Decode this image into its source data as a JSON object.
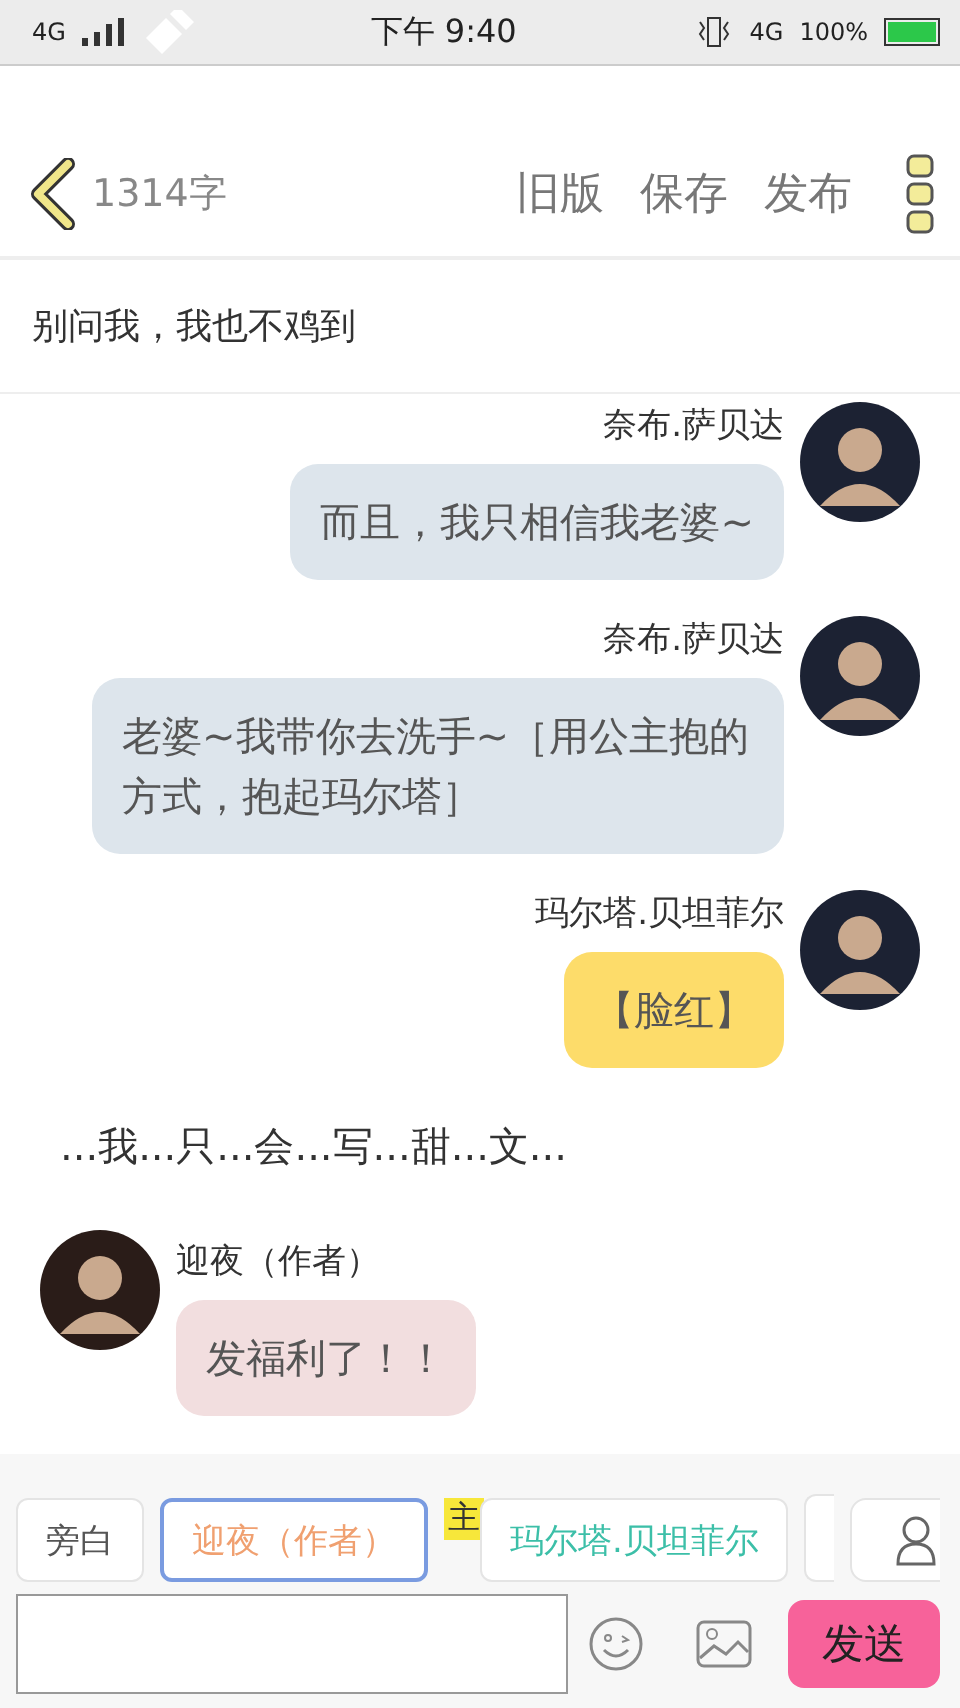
{
  "status_bar": {
    "network": "4G",
    "time": "下午 9:40",
    "network_2": "4G",
    "battery": "100%"
  },
  "header": {
    "word_count": "1314字",
    "actions": [
      "旧版",
      "保存",
      "发布"
    ]
  },
  "topic": "别问我，我也不鸡到",
  "messages": [
    {
      "kind": "right",
      "speaker": "奈布.萨贝达",
      "text": "而且，我只相信我老婆~",
      "color": "#dde5ec"
    },
    {
      "kind": "right",
      "speaker": "奈布.萨贝达",
      "text": "老婆~我带你去洗手~［用公主抱的方式，抱起玛尔塔］",
      "color": "#dde5ec"
    },
    {
      "kind": "right",
      "speaker": "玛尔塔.贝坦菲尔",
      "text": "【脸红】",
      "color": "#fddc6a"
    },
    {
      "kind": "narration",
      "text": "...我...只...会...写...甜...文..."
    },
    {
      "kind": "left",
      "speaker": "迎夜（作者）",
      "text": "发福利了！！",
      "color": "#f2dedf"
    }
  ],
  "roles": [
    {
      "label": "旁白",
      "selected": false,
      "color": "#555555"
    },
    {
      "label": "迎夜（作者）",
      "selected": true,
      "color": "#f0a070"
    },
    {
      "label": "玛尔塔.贝坦菲尔",
      "selected": false,
      "color": "#3cbfa8",
      "badge": "主"
    }
  ],
  "composer": {
    "send": "发送"
  }
}
